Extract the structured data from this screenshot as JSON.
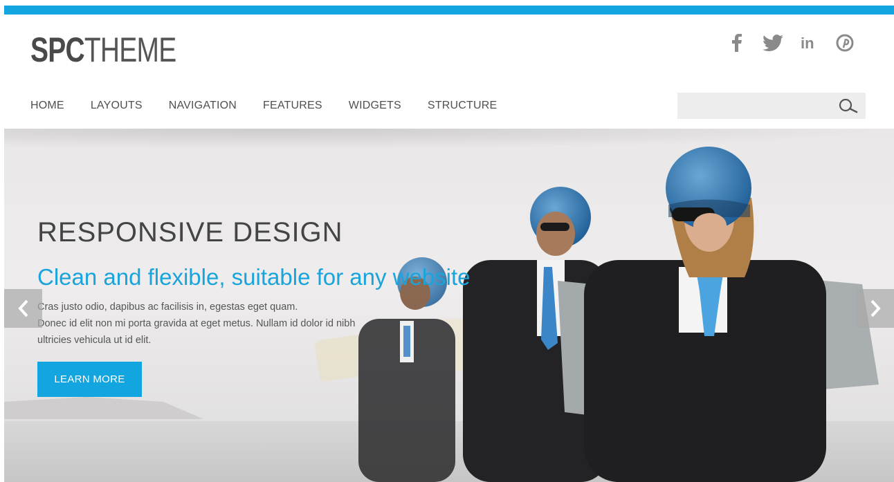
{
  "brand": {
    "logo_bold": "SPC",
    "logo_light": "THEME",
    "accent": "#12a5e0"
  },
  "social": [
    "facebook-icon",
    "twitter-icon",
    "linkedin-icon",
    "pinterest-icon"
  ],
  "nav": {
    "items": [
      {
        "label": "HOME"
      },
      {
        "label": "LAYOUTS"
      },
      {
        "label": "NAVIGATION"
      },
      {
        "label": "FEATURES"
      },
      {
        "label": "WIDGETS"
      },
      {
        "label": "STRUCTURE"
      }
    ]
  },
  "search": {
    "placeholder": "",
    "value": ""
  },
  "hero": {
    "headline": "RESPONSIVE DESIGN",
    "subhead": "Clean and flexible, suitable for any website",
    "body_line1": "Cras justo odio, dapibus ac facilisis in, egestas eget quam.",
    "body_line2": "Donec id elit non mi porta gravida at eget metus. Nullam id dolor id nibh",
    "body_line3": "ultricies vehicula ut id elit.",
    "cta_label": "LEARN MORE",
    "image": "photo of three people in suits with blue helmets and jetpacks"
  },
  "slider": {
    "prev": "chevron-left-icon",
    "next": "chevron-right-icon"
  }
}
